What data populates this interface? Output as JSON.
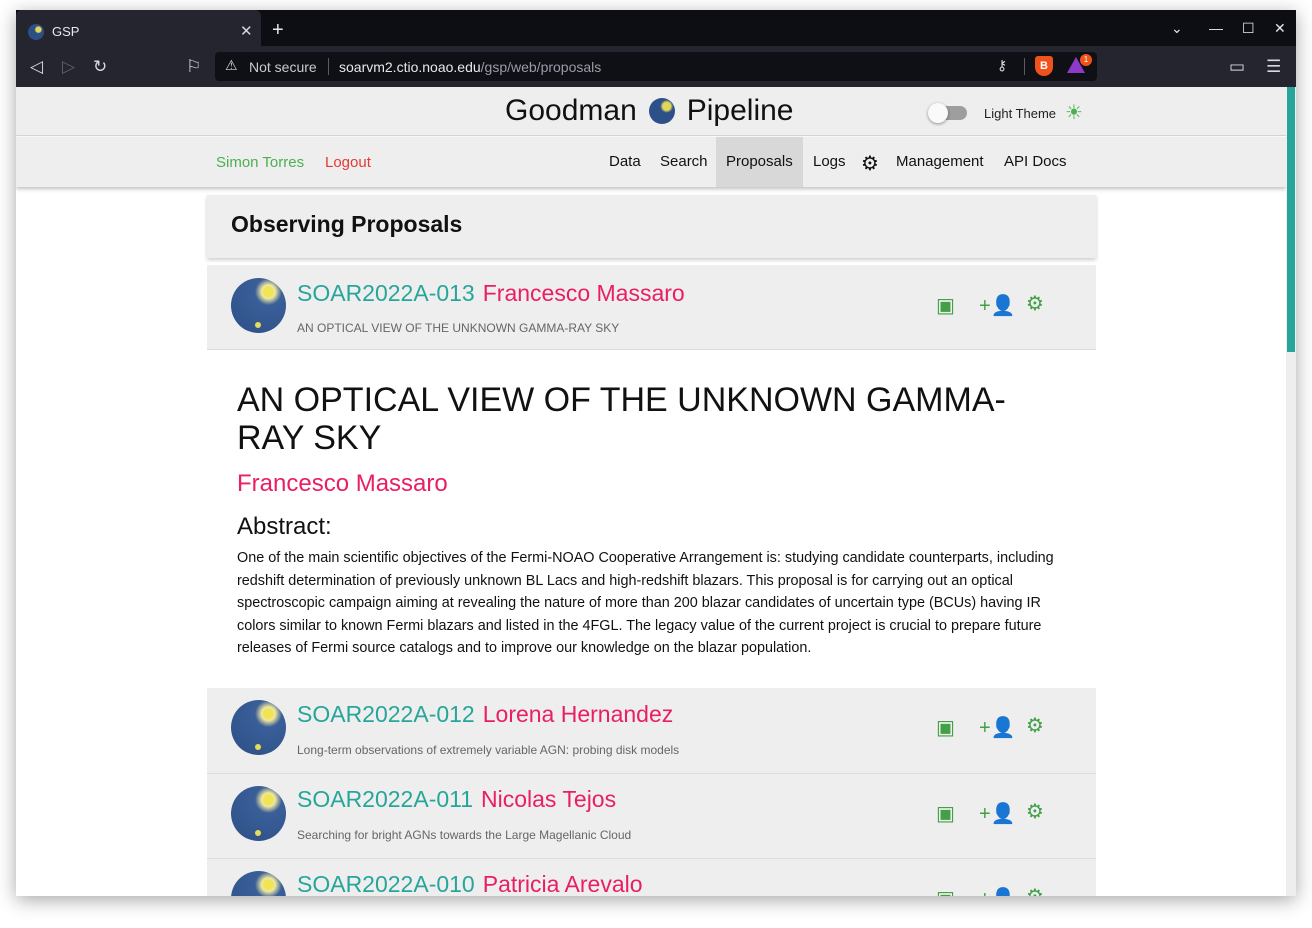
{
  "browser": {
    "tab_title": "GSP",
    "not_secure": "Not secure",
    "url_domain": "soarvm2.ctio.noao.edu",
    "url_path": "/gsp/web/proposals",
    "rewards_badge": "1"
  },
  "app": {
    "title_left": "Goodman",
    "title_right": "Pipeline",
    "theme_label": "Light Theme"
  },
  "nav": {
    "user": "Simon Torres",
    "logout": "Logout",
    "items": [
      "Data",
      "Search",
      "Proposals",
      "Logs",
      "Management",
      "API Docs"
    ],
    "active": "Proposals"
  },
  "page_title": "Observing Proposals",
  "proposals": [
    {
      "code": "SOAR2022A-013",
      "pi": "Francesco Massaro",
      "title": "AN OPTICAL VIEW OF THE UNKNOWN GAMMA-RAY SKY"
    },
    {
      "code": "SOAR2022A-012",
      "pi": "Lorena Hernandez",
      "title": "Long-term observations of extremely variable AGN: probing disk models"
    },
    {
      "code": "SOAR2022A-011",
      "pi": "Nicolas Tejos",
      "title": "Searching for bright AGNs towards the Large Magellanic Cloud"
    },
    {
      "code": "SOAR2022A-010",
      "pi": "Patricia Arevalo",
      "title": ""
    }
  ],
  "expanded": {
    "title": "AN OPTICAL VIEW OF THE UNKNOWN GAMMA-RAY SKY",
    "pi": "Francesco Massaro",
    "abstract_heading": "Abstract:",
    "abstract": "One of the main scientific objectives of the Fermi-NOAO Cooperative Arrangement is: studying candidate counterparts, including redshift determination of previously unknown BL Lacs and high-redshift blazars. This proposal is for carrying out an optical spectroscopic campaign aiming at revealing the nature of more than 200 blazar candidates of uncertain type (BCUs) having IR colors similar to known Fermi blazars and listed in the 4FGL. The legacy value of the current project is crucial to prepare future releases of Fermi source catalogs and to improve our knowledge on the blazar population."
  }
}
